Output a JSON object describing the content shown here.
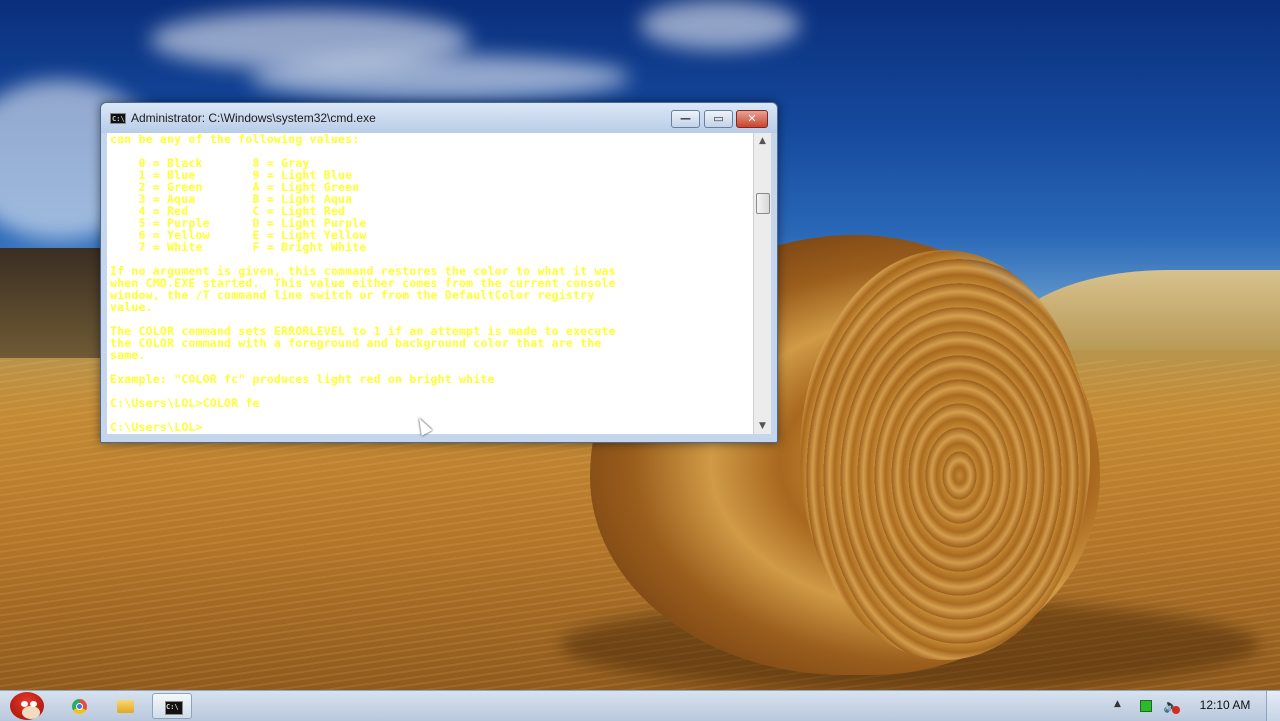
{
  "window": {
    "title": "Administrator: C:\\Windows\\system32\\cmd.exe",
    "icon": "cmd-icon",
    "buttons": {
      "minimize": "—",
      "maximize": "▭",
      "close": "✕"
    }
  },
  "console": {
    "text_color": "#ffff33",
    "background_color": "#ffffff",
    "lines": [
      "can be any of the following values:",
      "",
      "    0 = Black       8 = Gray",
      "    1 = Blue        9 = Light Blue",
      "    2 = Green       A = Light Green",
      "    3 = Aqua        B = Light Aqua",
      "    4 = Red         C = Light Red",
      "    5 = Purple      D = Light Purple",
      "    6 = Yellow      E = Light Yellow",
      "    7 = White       F = Bright White",
      "",
      "If no argument is given, this command restores the color to what it was",
      "when CMD.EXE started.  This value either comes from the current console",
      "window, the /T command line switch or from the DefaultColor registry",
      "value.",
      "",
      "The COLOR command sets ERRORLEVEL to 1 if an attempt is made to execute",
      "the COLOR command with a foreground and background color that are the",
      "same.",
      "",
      "Example: \"COLOR fc\" produces light red on bright white",
      "",
      "C:\\Users\\LOL>COLOR fe",
      "",
      "C:\\Users\\LOL>"
    ]
  },
  "scrollbar": {
    "up_arrow": "▲",
    "down_arrow": "▼"
  },
  "taskbar": {
    "items": [
      {
        "name": "start-button",
        "icon": "angry-bird-icon"
      },
      {
        "name": "chrome-taskbar-item",
        "icon": "chrome-icon"
      },
      {
        "name": "explorer-taskbar-item",
        "icon": "folder-icon"
      },
      {
        "name": "cmd-taskbar-item",
        "icon": "cmd-icon",
        "active": true
      }
    ],
    "tray": {
      "expand_arrow": "▲",
      "speaker": "🔈",
      "clock": "12:10 AM"
    }
  }
}
